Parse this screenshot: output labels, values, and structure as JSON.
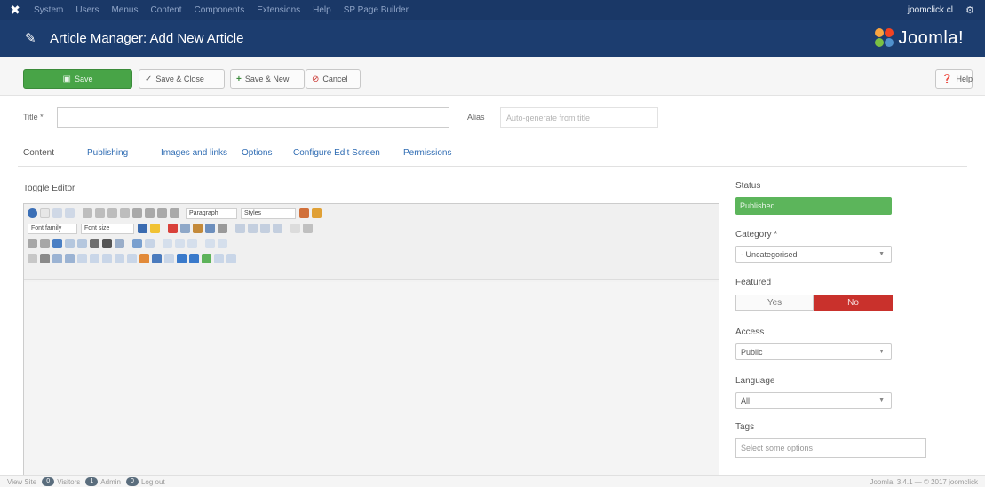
{
  "topnav": {
    "logo_icon": "joomla-icon",
    "items": [
      "System",
      "Users",
      "Menus",
      "Content",
      "Components",
      "Extensions",
      "Help",
      "SP Page Builder"
    ],
    "site_name": "joomclick.cl",
    "gear_icon": "gear-icon"
  },
  "header": {
    "title": "Article Manager: Add New Article",
    "brand": "Joomla!",
    "colors": {
      "nav": "#1a3867",
      "header": "#1c3d6f"
    }
  },
  "toolbar": {
    "save_label": "Save",
    "save_close_label": "Save & Close",
    "save_new_label": "Save & New",
    "cancel_label": "Cancel",
    "help_label": "Help",
    "save_color": "#48a447"
  },
  "form": {
    "title_label": "Title *",
    "title_value": "",
    "alias_label": "Alias",
    "alias_placeholder": "Auto-generate from title"
  },
  "tabs": [
    {
      "label": "Content",
      "active": true
    },
    {
      "label": "Publishing",
      "active": false
    },
    {
      "label": "Images and links",
      "active": false
    },
    {
      "label": "Options",
      "active": false
    },
    {
      "label": "Configure Edit Screen",
      "active": false
    },
    {
      "label": "Permissions",
      "active": false
    }
  ],
  "editor": {
    "toggle_label": "Toggle Editor",
    "format_select": "Paragraph",
    "styles_select": "Styles",
    "font_family_select": "Font family",
    "font_size_select": "Font size"
  },
  "sidebar": {
    "status_label": "Status",
    "status_value": "Published",
    "status_color": "#5cb55b",
    "category_label": "Category *",
    "category_value": "- Uncategorised",
    "featured_label": "Featured",
    "featured_yes": "Yes",
    "featured_no": "No",
    "featured_no_color": "#c9312c",
    "access_label": "Access",
    "access_value": "Public",
    "language_label": "Language",
    "language_value": "All",
    "tags_label": "Tags",
    "tags_placeholder": "Select some options"
  },
  "footer": {
    "view_site": "View Site",
    "visitors_count": "0",
    "visitors_label": "Visitors",
    "admin_count": "1",
    "admin_label": "Admin",
    "messages_count": "0",
    "logout_label": "Log out",
    "copyright": "Joomla! 3.4.1 — © 2017 joomclick"
  }
}
